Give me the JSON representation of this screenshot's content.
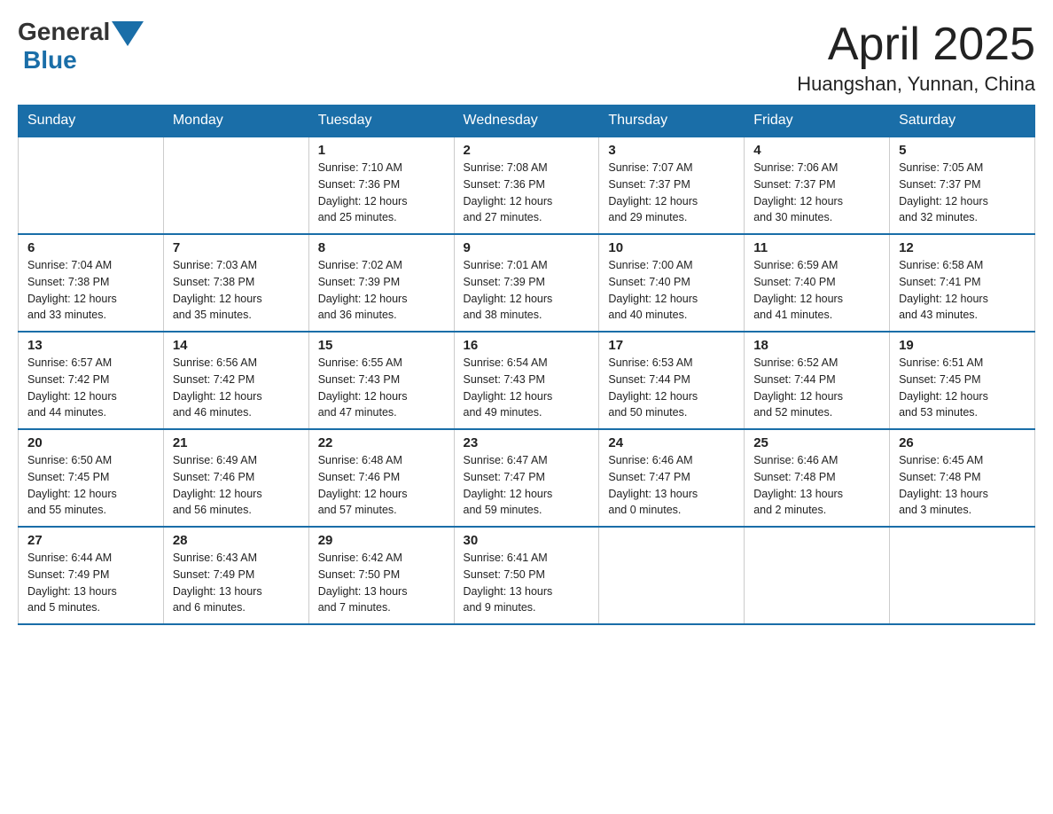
{
  "logo": {
    "general": "General",
    "blue": "Blue"
  },
  "title": {
    "month_year": "April 2025",
    "location": "Huangshan, Yunnan, China"
  },
  "headers": [
    "Sunday",
    "Monday",
    "Tuesday",
    "Wednesday",
    "Thursday",
    "Friday",
    "Saturday"
  ],
  "weeks": [
    [
      {
        "day": "",
        "info": ""
      },
      {
        "day": "",
        "info": ""
      },
      {
        "day": "1",
        "info": "Sunrise: 7:10 AM\nSunset: 7:36 PM\nDaylight: 12 hours\nand 25 minutes."
      },
      {
        "day": "2",
        "info": "Sunrise: 7:08 AM\nSunset: 7:36 PM\nDaylight: 12 hours\nand 27 minutes."
      },
      {
        "day": "3",
        "info": "Sunrise: 7:07 AM\nSunset: 7:37 PM\nDaylight: 12 hours\nand 29 minutes."
      },
      {
        "day": "4",
        "info": "Sunrise: 7:06 AM\nSunset: 7:37 PM\nDaylight: 12 hours\nand 30 minutes."
      },
      {
        "day": "5",
        "info": "Sunrise: 7:05 AM\nSunset: 7:37 PM\nDaylight: 12 hours\nand 32 minutes."
      }
    ],
    [
      {
        "day": "6",
        "info": "Sunrise: 7:04 AM\nSunset: 7:38 PM\nDaylight: 12 hours\nand 33 minutes."
      },
      {
        "day": "7",
        "info": "Sunrise: 7:03 AM\nSunset: 7:38 PM\nDaylight: 12 hours\nand 35 minutes."
      },
      {
        "day": "8",
        "info": "Sunrise: 7:02 AM\nSunset: 7:39 PM\nDaylight: 12 hours\nand 36 minutes."
      },
      {
        "day": "9",
        "info": "Sunrise: 7:01 AM\nSunset: 7:39 PM\nDaylight: 12 hours\nand 38 minutes."
      },
      {
        "day": "10",
        "info": "Sunrise: 7:00 AM\nSunset: 7:40 PM\nDaylight: 12 hours\nand 40 minutes."
      },
      {
        "day": "11",
        "info": "Sunrise: 6:59 AM\nSunset: 7:40 PM\nDaylight: 12 hours\nand 41 minutes."
      },
      {
        "day": "12",
        "info": "Sunrise: 6:58 AM\nSunset: 7:41 PM\nDaylight: 12 hours\nand 43 minutes."
      }
    ],
    [
      {
        "day": "13",
        "info": "Sunrise: 6:57 AM\nSunset: 7:42 PM\nDaylight: 12 hours\nand 44 minutes."
      },
      {
        "day": "14",
        "info": "Sunrise: 6:56 AM\nSunset: 7:42 PM\nDaylight: 12 hours\nand 46 minutes."
      },
      {
        "day": "15",
        "info": "Sunrise: 6:55 AM\nSunset: 7:43 PM\nDaylight: 12 hours\nand 47 minutes."
      },
      {
        "day": "16",
        "info": "Sunrise: 6:54 AM\nSunset: 7:43 PM\nDaylight: 12 hours\nand 49 minutes."
      },
      {
        "day": "17",
        "info": "Sunrise: 6:53 AM\nSunset: 7:44 PM\nDaylight: 12 hours\nand 50 minutes."
      },
      {
        "day": "18",
        "info": "Sunrise: 6:52 AM\nSunset: 7:44 PM\nDaylight: 12 hours\nand 52 minutes."
      },
      {
        "day": "19",
        "info": "Sunrise: 6:51 AM\nSunset: 7:45 PM\nDaylight: 12 hours\nand 53 minutes."
      }
    ],
    [
      {
        "day": "20",
        "info": "Sunrise: 6:50 AM\nSunset: 7:45 PM\nDaylight: 12 hours\nand 55 minutes."
      },
      {
        "day": "21",
        "info": "Sunrise: 6:49 AM\nSunset: 7:46 PM\nDaylight: 12 hours\nand 56 minutes."
      },
      {
        "day": "22",
        "info": "Sunrise: 6:48 AM\nSunset: 7:46 PM\nDaylight: 12 hours\nand 57 minutes."
      },
      {
        "day": "23",
        "info": "Sunrise: 6:47 AM\nSunset: 7:47 PM\nDaylight: 12 hours\nand 59 minutes."
      },
      {
        "day": "24",
        "info": "Sunrise: 6:46 AM\nSunset: 7:47 PM\nDaylight: 13 hours\nand 0 minutes."
      },
      {
        "day": "25",
        "info": "Sunrise: 6:46 AM\nSunset: 7:48 PM\nDaylight: 13 hours\nand 2 minutes."
      },
      {
        "day": "26",
        "info": "Sunrise: 6:45 AM\nSunset: 7:48 PM\nDaylight: 13 hours\nand 3 minutes."
      }
    ],
    [
      {
        "day": "27",
        "info": "Sunrise: 6:44 AM\nSunset: 7:49 PM\nDaylight: 13 hours\nand 5 minutes."
      },
      {
        "day": "28",
        "info": "Sunrise: 6:43 AM\nSunset: 7:49 PM\nDaylight: 13 hours\nand 6 minutes."
      },
      {
        "day": "29",
        "info": "Sunrise: 6:42 AM\nSunset: 7:50 PM\nDaylight: 13 hours\nand 7 minutes."
      },
      {
        "day": "30",
        "info": "Sunrise: 6:41 AM\nSunset: 7:50 PM\nDaylight: 13 hours\nand 9 minutes."
      },
      {
        "day": "",
        "info": ""
      },
      {
        "day": "",
        "info": ""
      },
      {
        "day": "",
        "info": ""
      }
    ]
  ]
}
